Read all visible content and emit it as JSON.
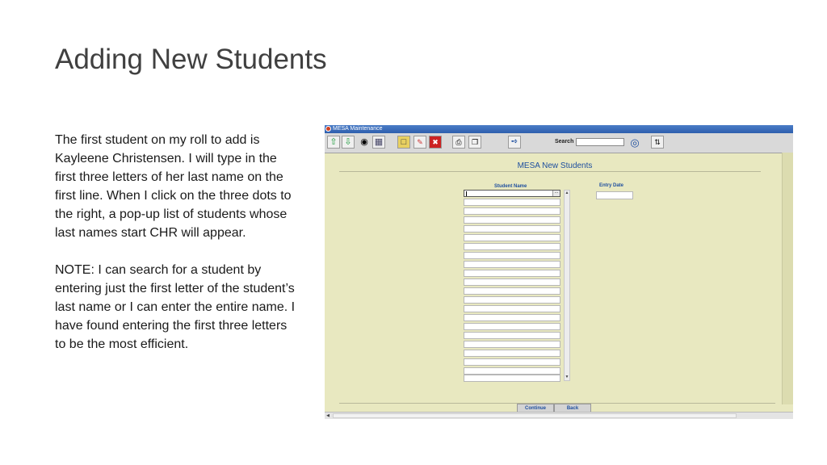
{
  "slide": {
    "title": "Adding New Students",
    "paragraph1": "The first student on my roll to add is Kayleene Christensen.  I will type in the first three letters of her last name on the first line.  When I click on the three dots to the right, a pop-up list of students whose last names start CHR will appear.",
    "paragraph2": "NOTE:  I can search for a student by entering just the first letter of the student’s last name or I can enter the entire name.  I have found entering the first three letters to be the most efficient."
  },
  "app": {
    "window_title": "MESA Maintenance",
    "toolbar": {
      "search_label": "Search",
      "search_value": "",
      "icons": [
        "arrow-up-icon",
        "arrow-down-icon",
        "binoculars-icon",
        "save-icon",
        "new-record-icon",
        "pencil-icon",
        "delete-icon",
        "print-icon",
        "copy-icon",
        "runner-icon",
        "refresh-icon",
        "sort-icon"
      ]
    },
    "form": {
      "title": "MESA New Students",
      "student_name_header": "Student Name",
      "entry_date_header": "Entry Date",
      "student_rows": [
        "",
        "",
        "",
        "",
        "",
        "",
        "",
        "",
        "",
        "",
        "",
        "",
        "",
        "",
        "",
        "",
        "",
        "",
        "",
        "",
        "",
        ""
      ],
      "lookup_button_label": "...",
      "entry_date_value": ""
    },
    "buttons": {
      "continue": "Continue",
      "back": "Back"
    },
    "colors": {
      "form_background": "#e8e8c0",
      "accent_blue": "#1d4e9e"
    }
  }
}
